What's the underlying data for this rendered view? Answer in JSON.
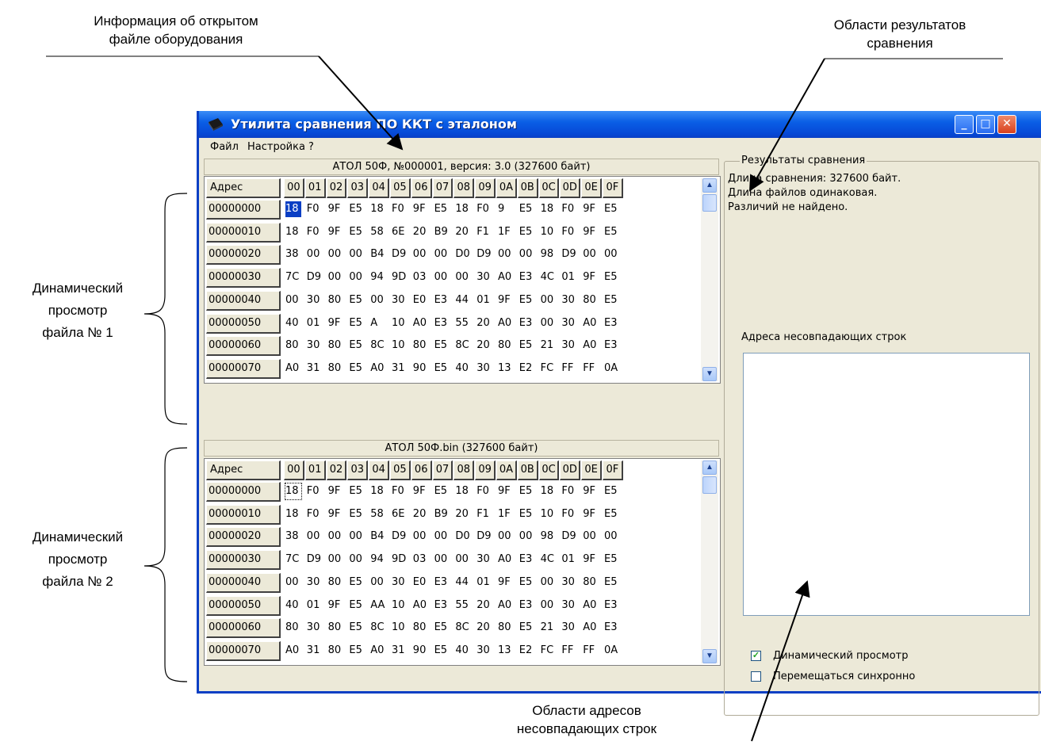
{
  "annotations": {
    "file_info": "Информация об открытом\nфайле оборудования",
    "compare_results": "Области результатов\nсравнения",
    "dynamic_view_1": "Динамический\nпросмотр\nфайла № 1",
    "dynamic_view_2": "Динамический\nпросмотр\nфайла № 2",
    "diff_addresses": "Области адресов\nнесовпадающих строк"
  },
  "window": {
    "title": "Утилита сравнения ПО ККТ с эталоном",
    "buttons": {
      "minimize": "_",
      "maximize": "□",
      "close": "✕"
    }
  },
  "menu": {
    "file": "Файл",
    "settings": "Настройка",
    "help": "?"
  },
  "viewer1": {
    "header": "АТОЛ 50Ф, №000001, версия: 3.0 (327600 байт)",
    "address_label": "Адрес",
    "columns": [
      "00",
      "01",
      "02",
      "03",
      "04",
      "05",
      "06",
      "07",
      "08",
      "09",
      "0A",
      "0B",
      "0C",
      "0D",
      "0E",
      "0F"
    ],
    "rows": [
      {
        "addr": "00000000",
        "bytes": [
          "18",
          "F0",
          "9F",
          "E5",
          "18",
          "F0",
          "9F",
          "E5",
          "18",
          "F0",
          "9",
          "E5",
          "18",
          "F0",
          "9F",
          "E5"
        ]
      },
      {
        "addr": "00000010",
        "bytes": [
          "18",
          "F0",
          "9F",
          "E5",
          "58",
          "6E",
          "20",
          "B9",
          "20",
          "F1",
          "1F",
          "E5",
          "10",
          "F0",
          "9F",
          "E5"
        ]
      },
      {
        "addr": "00000020",
        "bytes": [
          "38",
          "00",
          "00",
          "00",
          "B4",
          "D9",
          "00",
          "00",
          "D0",
          "D9",
          "00",
          "00",
          "98",
          "D9",
          "00",
          "00"
        ]
      },
      {
        "addr": "00000030",
        "bytes": [
          "7C",
          "D9",
          "00",
          "00",
          "94",
          "9D",
          "03",
          "00",
          "00",
          "30",
          "A0",
          "E3",
          "4C",
          "01",
          "9F",
          "E5"
        ]
      },
      {
        "addr": "00000040",
        "bytes": [
          "00",
          "30",
          "80",
          "E5",
          "00",
          "30",
          "E0",
          "E3",
          "44",
          "01",
          "9F",
          "E5",
          "00",
          "30",
          "80",
          "E5"
        ]
      },
      {
        "addr": "00000050",
        "bytes": [
          "40",
          "01",
          "9F",
          "E5",
          "A",
          "10",
          "A0",
          "E3",
          "55",
          "20",
          "A0",
          "E3",
          "00",
          "30",
          "A0",
          "E3"
        ]
      },
      {
        "addr": "00000060",
        "bytes": [
          "80",
          "30",
          "80",
          "E5",
          "8C",
          "10",
          "80",
          "E5",
          "8C",
          "20",
          "80",
          "E5",
          "21",
          "30",
          "A0",
          "E3"
        ]
      },
      {
        "addr": "00000070",
        "bytes": [
          "A0",
          "31",
          "80",
          "E5",
          "A0",
          "31",
          "90",
          "E5",
          "40",
          "30",
          "13",
          "E2",
          "FC",
          "FF",
          "FF",
          "0A"
        ]
      }
    ]
  },
  "viewer2": {
    "header": "АТОЛ 50Ф.bin (327600 байт)",
    "address_label": "Адрес",
    "columns": [
      "00",
      "01",
      "02",
      "03",
      "04",
      "05",
      "06",
      "07",
      "08",
      "09",
      "0A",
      "0B",
      "0C",
      "0D",
      "0E",
      "0F"
    ],
    "rows": [
      {
        "addr": "00000000",
        "bytes": [
          "18",
          "F0",
          "9F",
          "E5",
          "18",
          "F0",
          "9F",
          "E5",
          "18",
          "F0",
          "9F",
          "E5",
          "18",
          "F0",
          "9F",
          "E5"
        ]
      },
      {
        "addr": "00000010",
        "bytes": [
          "18",
          "F0",
          "9F",
          "E5",
          "58",
          "6E",
          "20",
          "B9",
          "20",
          "F1",
          "1F",
          "E5",
          "10",
          "F0",
          "9F",
          "E5"
        ]
      },
      {
        "addr": "00000020",
        "bytes": [
          "38",
          "00",
          "00",
          "00",
          "B4",
          "D9",
          "00",
          "00",
          "D0",
          "D9",
          "00",
          "00",
          "98",
          "D9",
          "00",
          "00"
        ]
      },
      {
        "addr": "00000030",
        "bytes": [
          "7C",
          "D9",
          "00",
          "00",
          "94",
          "9D",
          "03",
          "00",
          "00",
          "30",
          "A0",
          "E3",
          "4C",
          "01",
          "9F",
          "E5"
        ]
      },
      {
        "addr": "00000040",
        "bytes": [
          "00",
          "30",
          "80",
          "E5",
          "00",
          "30",
          "E0",
          "E3",
          "44",
          "01",
          "9F",
          "E5",
          "00",
          "30",
          "80",
          "E5"
        ]
      },
      {
        "addr": "00000050",
        "bytes": [
          "40",
          "01",
          "9F",
          "E5",
          "AA",
          "10",
          "A0",
          "E3",
          "55",
          "20",
          "A0",
          "E3",
          "00",
          "30",
          "A0",
          "E3"
        ]
      },
      {
        "addr": "00000060",
        "bytes": [
          "80",
          "30",
          "80",
          "E5",
          "8C",
          "10",
          "80",
          "E5",
          "8C",
          "20",
          "80",
          "E5",
          "21",
          "30",
          "A0",
          "E3"
        ]
      },
      {
        "addr": "00000070",
        "bytes": [
          "A0",
          "31",
          "80",
          "E5",
          "A0",
          "31",
          "90",
          "E5",
          "40",
          "30",
          "13",
          "E2",
          "FC",
          "FF",
          "FF",
          "0A"
        ]
      }
    ]
  },
  "results": {
    "group_title": "Результаты сравнения",
    "line1": "Длина сравнения: 327600 байт.",
    "line2": "Длина файлов одинаковая.",
    "line3": "Различий не найдено.",
    "diff_label": "Адреса несовпадающих строк"
  },
  "options": {
    "dynamic_view_label": "Динамический просмотр",
    "dynamic_view_checked": true,
    "sync_move_label": "Перемещаться синхронно",
    "sync_move_checked": false
  },
  "colors": {
    "titlebar": "#0a5fe6",
    "selection": "#0a3fc4",
    "window_bg": "#ece9d8"
  }
}
